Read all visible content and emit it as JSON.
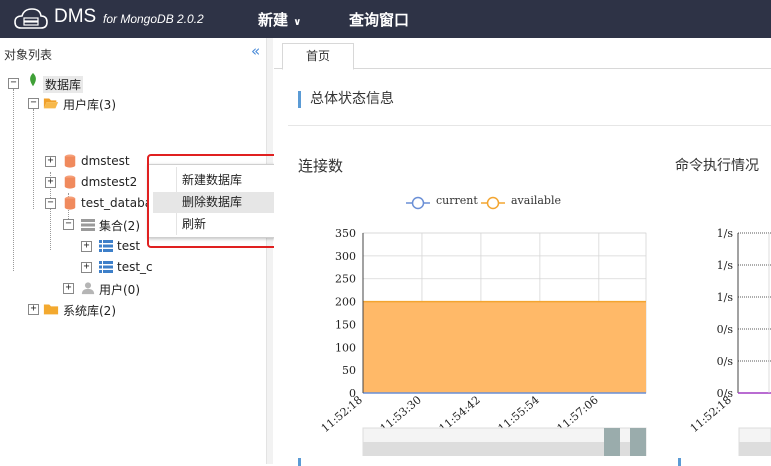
{
  "app": {
    "name": "DMS",
    "subtitle": "for MongoDB 2.0.2"
  },
  "menu": {
    "new_label": "新建",
    "query_label": "查询窗口"
  },
  "sidebar": {
    "title": "对象列表",
    "tree": {
      "root": "数据库",
      "user_db": "用户库(3)",
      "dbs": [
        "dmstest",
        "dmstest2",
        "test_database"
      ],
      "collections": "集合(2)",
      "coll_items": [
        "test",
        "test_c"
      ],
      "users": "用户(0)",
      "system_db": "系统库(2)"
    }
  },
  "context_menu": {
    "items": [
      "新建数据库",
      "删除数据库",
      "刷新"
    ],
    "highlighted_index": 1
  },
  "tabs": {
    "home": "首页"
  },
  "main": {
    "section_title": "总体状态信息",
    "conn_title": "连接数",
    "cmd_title": "命令执行情况"
  },
  "colors": {
    "topbar": "#2e3346",
    "accent": "#5b9bd5",
    "current_series": "#6a8fd6",
    "available_series": "#f3a530",
    "highlight_border": "#e02020"
  },
  "chart_data": [
    {
      "type": "area",
      "title": "连接数",
      "legend": [
        "current",
        "available"
      ],
      "legend_position": "top",
      "x": [
        "11:52:18",
        "11:53:30",
        "11:54:42",
        "11:55:54",
        "11:57:06"
      ],
      "series": [
        {
          "name": "current",
          "values": [
            0,
            0,
            0,
            0,
            0
          ]
        },
        {
          "name": "available",
          "values": [
            200,
            200,
            200,
            200,
            200
          ]
        }
      ],
      "yticks": [
        0,
        50,
        100,
        150,
        200,
        250,
        300,
        350
      ],
      "ylim": [
        0,
        350
      ],
      "grid": true
    },
    {
      "type": "line",
      "title": "命令执行情况",
      "x": [
        "11:52:18"
      ],
      "yticks": [
        "0/s",
        "0/s",
        "0/s",
        "1/s",
        "1/s",
        "1/s"
      ],
      "grid": true
    }
  ]
}
